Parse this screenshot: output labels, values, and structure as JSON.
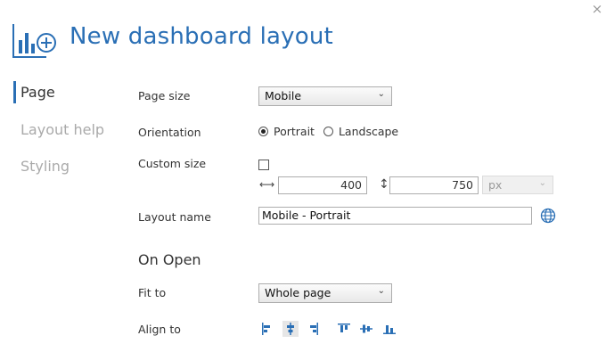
{
  "window": {
    "close_glyph": "×"
  },
  "header": {
    "title": "New dashboard layout",
    "icon": "dashboard-add-icon"
  },
  "nav": {
    "items": [
      "Page",
      "Layout help",
      "Styling"
    ],
    "active": "Page"
  },
  "page": {
    "page_size": {
      "label": "Page size",
      "value": "Mobile"
    },
    "orientation": {
      "label": "Orientation",
      "options": [
        "Portrait",
        "Landscape"
      ],
      "selected": "Portrait"
    },
    "custom_size": {
      "label": "Custom size",
      "checked": false,
      "width": "400",
      "height": "750",
      "unit": "px"
    },
    "layout_name": {
      "label": "Layout name",
      "value": "Mobile - Portrait"
    }
  },
  "on_open": {
    "title": "On Open",
    "fit_to": {
      "label": "Fit to",
      "value": "Whole page"
    },
    "align_to": {
      "label": "Align to",
      "selected_horizontal": "center"
    }
  },
  "colors": {
    "accent": "#2a6fb5",
    "text": "#333333",
    "inactive": "#aaaaaa"
  }
}
